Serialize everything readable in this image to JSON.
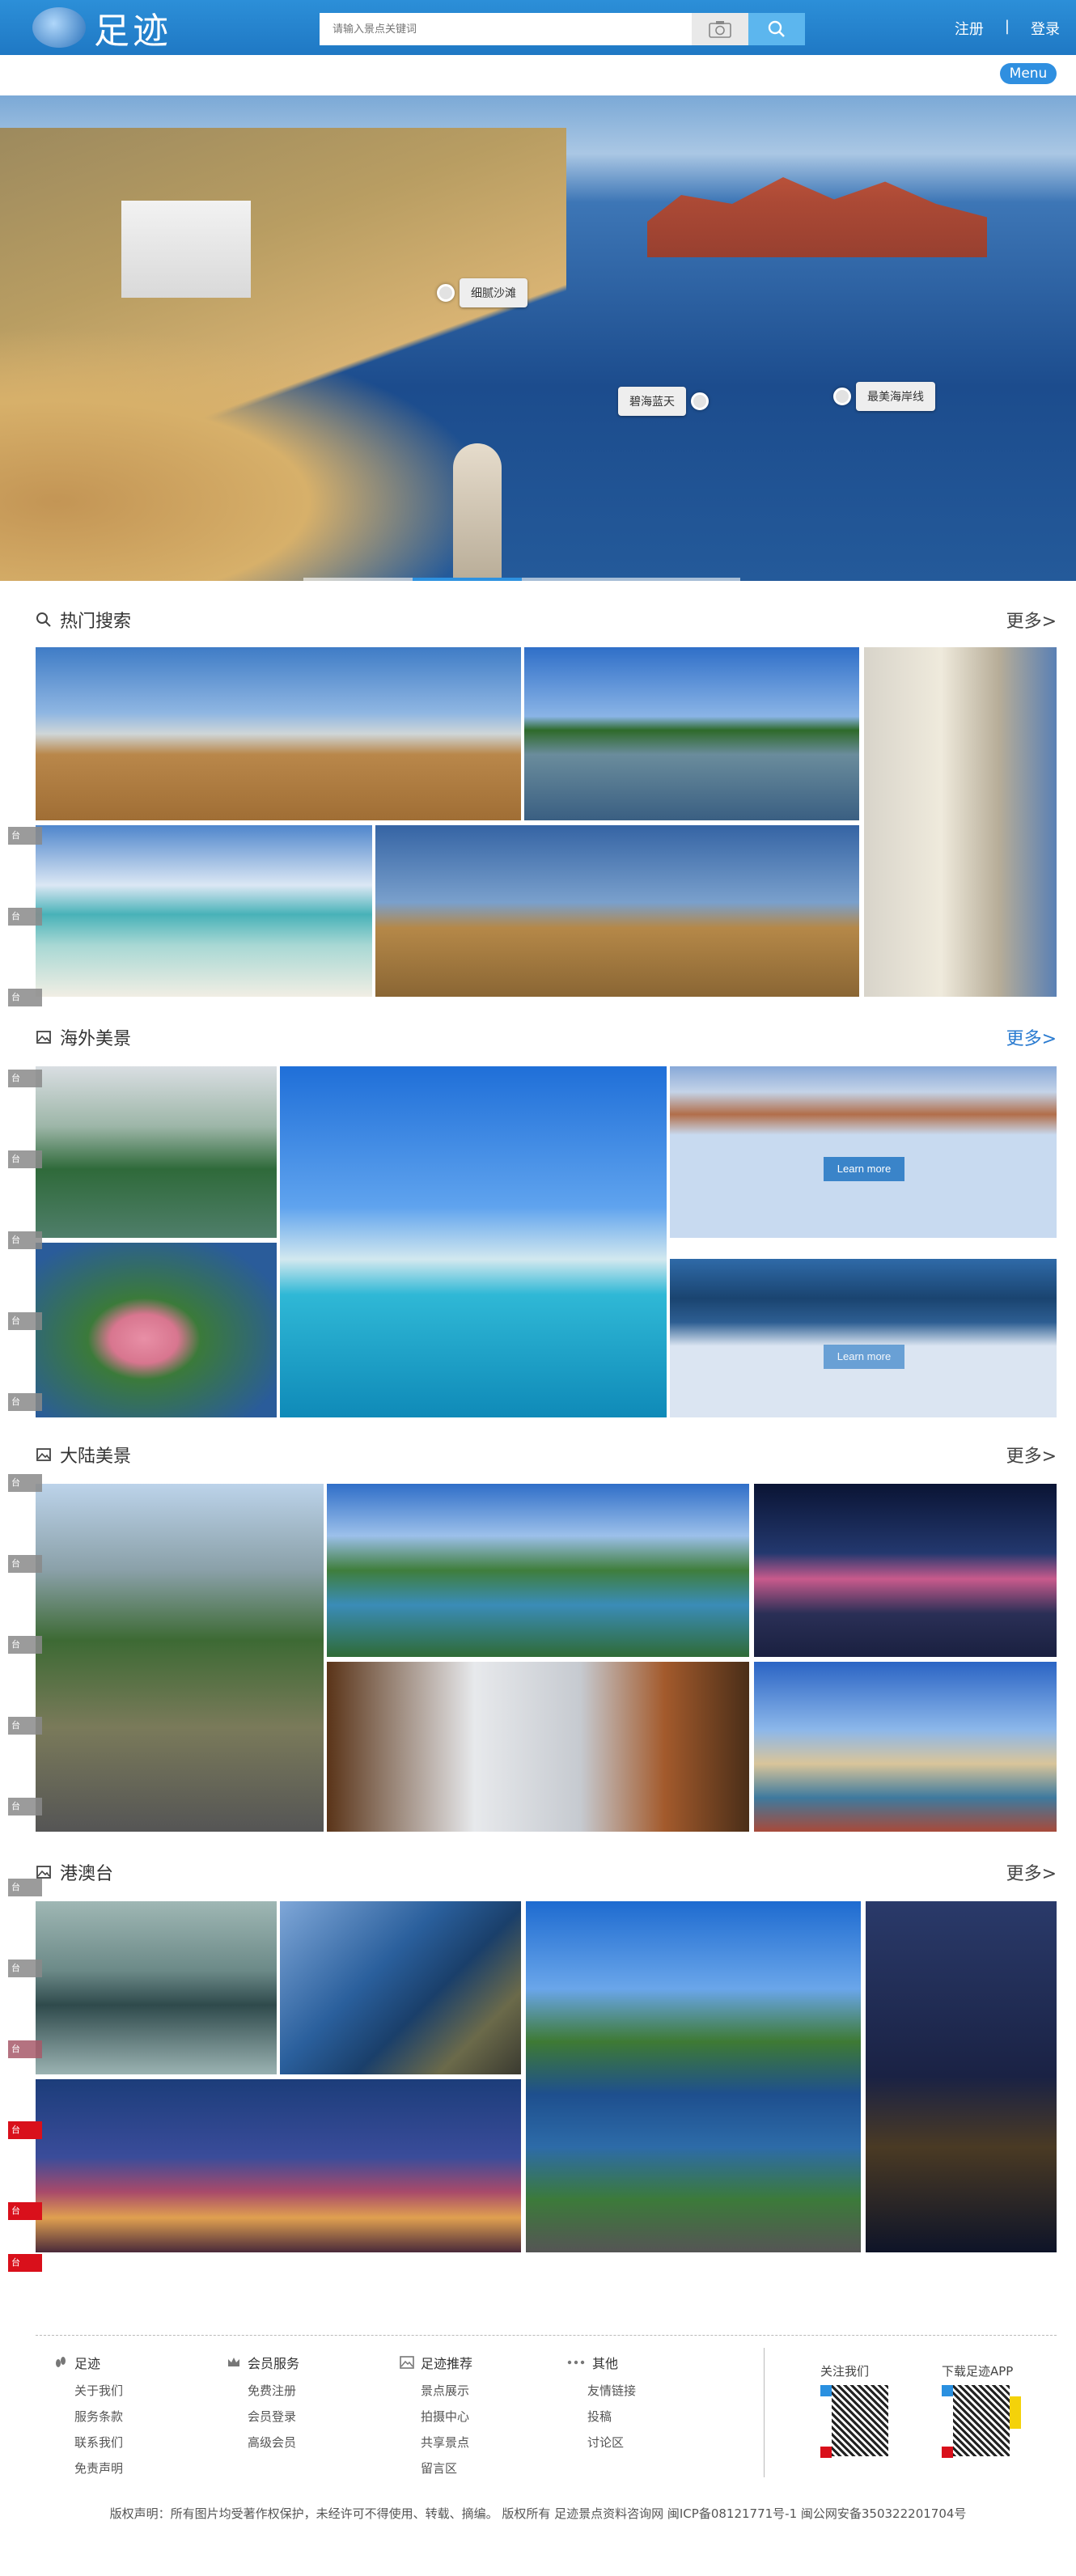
{
  "header": {
    "logo_text": "足迹",
    "search_placeholder": "请输入景点关键词",
    "register": "注册",
    "separator": "|",
    "login": "登录",
    "menu": "Menu"
  },
  "hero": {
    "tags": [
      "细腻沙滩",
      "碧海蓝天",
      "最美海岸线"
    ]
  },
  "sections": [
    {
      "title": "热门搜索",
      "more": "更多>",
      "icon": "search-icon"
    },
    {
      "title": "海外美景",
      "more": "更多>",
      "icon": "image-icon"
    },
    {
      "title": "大陆美景",
      "more": "更多>",
      "icon": "image-icon"
    },
    {
      "title": "港澳台",
      "more": "更多>",
      "icon": "image-icon"
    }
  ],
  "learn_more": "Learn more",
  "side_tag": "台",
  "footer": {
    "columns": [
      {
        "title": "足迹",
        "icon": "footprint-icon",
        "items": [
          "关于我们",
          "服务条款",
          "联系我们",
          "免责声明"
        ]
      },
      {
        "title": "会员服务",
        "icon": "crown-icon",
        "items": [
          "免费注册",
          "会员登录",
          "高级会员"
        ]
      },
      {
        "title": "足迹推荐",
        "icon": "picture-icon",
        "items": [
          "景点展示",
          "拍摄中心",
          "共享景点",
          "留言区"
        ]
      },
      {
        "title": "其他",
        "icon": "more-dots-icon",
        "items": [
          "友情链接",
          "投稿",
          "讨论区"
        ]
      }
    ],
    "follow_us": "关注我们",
    "download_app": "下载足迹APP",
    "copyright": "版权声明：所有图片均受著作权保护，未经许可不得使用、转载、摘编。 版权所有 足迹景点资料咨询网 闽ICP备08121771号-1 闽公网安备35032220170​4号"
  }
}
